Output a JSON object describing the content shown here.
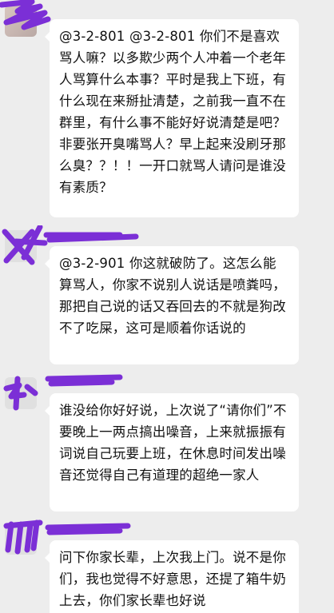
{
  "messages": [
    {
      "sender": "",
      "text": "@3-2-801 @3-2-801  你们不是喜欢骂人嘛？以多欺少两个人冲着一个老年人骂算什么本事？平时是我上下班，有什么现在来掰扯清楚，之前我一直不在群里，有什么事不能好好说清楚是吧？非要张开臭嘴骂人？早上起来没刷牙那么臭？？！！一开口就骂人请问是谁没有素质？"
    },
    {
      "sender": "",
      "text": "@3-2-901  你这就破防了。这怎么能算骂人，你家不说别人说话是喷粪吗，那把自己说的话又吞回去的不就是狗改不了吃屎，这可是顺着你话说的"
    },
    {
      "sender": "",
      "text": "谁没给你好好说，上次说了“请你们”不要晚上一两点搞出噪音，上来就振振有词说自己玩要上班，在休息时间发出噪音还觉得自己有道理的超绝一家人"
    },
    {
      "sender": "",
      "text": "问下你家长辈，上次我上门。说不是你们，我也觉得不好意思，还提了箱牛奶上去，你们家长辈也好说"
    }
  ],
  "colors": {
    "background": "#ededed",
    "bubble": "#ffffff",
    "redaction": "#7b2fd6"
  }
}
